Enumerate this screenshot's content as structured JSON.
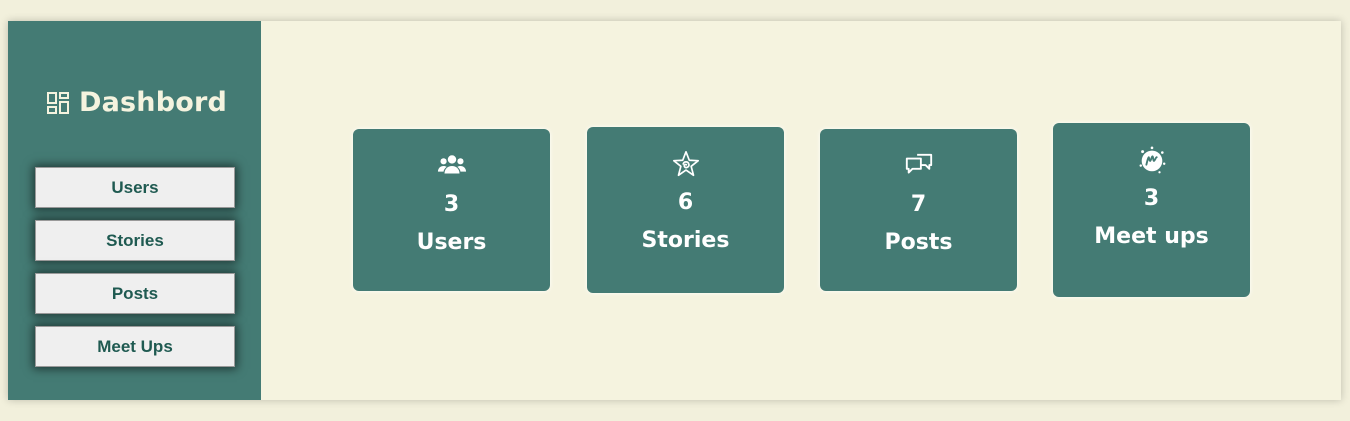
{
  "sidebar": {
    "title": "Dashbord",
    "buttons": [
      {
        "label": "Users"
      },
      {
        "label": "Stories"
      },
      {
        "label": "Posts"
      },
      {
        "label": "Meet Ups"
      }
    ]
  },
  "cards": [
    {
      "count": "3",
      "label": "Users",
      "icon": "users-icon"
    },
    {
      "count": "6",
      "label": "Stories",
      "icon": "star-swirl-icon"
    },
    {
      "count": "7",
      "label": "Posts",
      "icon": "chat-bubbles-icon"
    },
    {
      "count": "3",
      "label": "Meet ups",
      "icon": "meetup-icon"
    }
  ],
  "colors": {
    "accent": "#447b74",
    "background": "#f5f3df",
    "button_bg": "#efefef",
    "button_text": "#1f5a51"
  }
}
